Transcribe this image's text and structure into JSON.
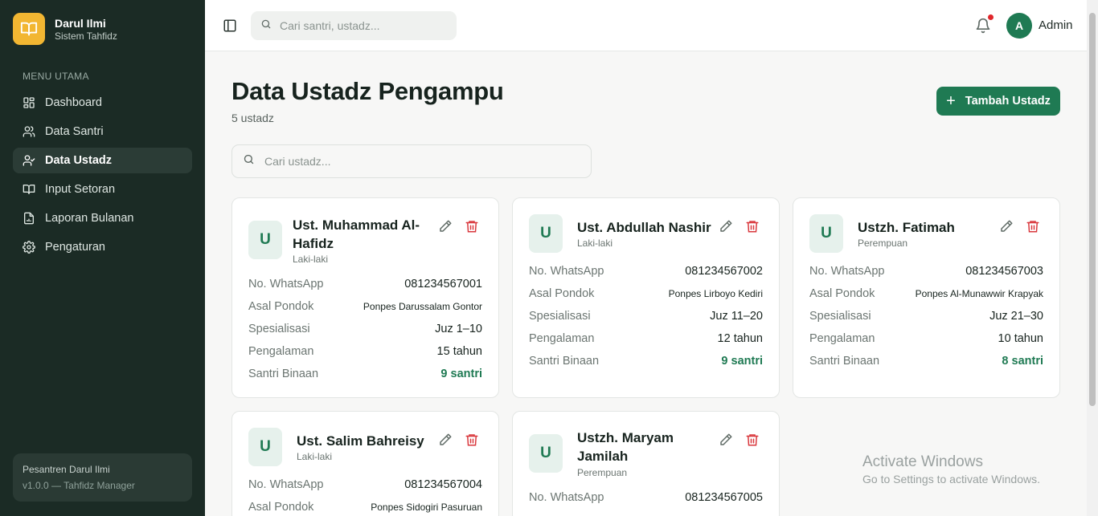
{
  "app": {
    "name": "Darul Ilmi",
    "subtitle": "Sistem Tahfidz"
  },
  "sidebar": {
    "menu_title": "MENU UTAMA",
    "items": [
      {
        "label": "Dashboard",
        "icon": "grid-icon"
      },
      {
        "label": "Data Santri",
        "icon": "users-icon"
      },
      {
        "label": "Data Ustadz",
        "icon": "user-check-icon",
        "active": true
      },
      {
        "label": "Input Setoran",
        "icon": "book-open-icon"
      },
      {
        "label": "Laporan Bulanan",
        "icon": "file-chart-icon"
      },
      {
        "label": "Pengaturan",
        "icon": "gear-icon"
      }
    ],
    "footer": {
      "line1": "Pesantren Darul Ilmi",
      "line2": "v1.0.0 — Tahfidz Manager"
    }
  },
  "topbar": {
    "search_placeholder": "Cari santri, ustadz...",
    "avatar_initial": "A",
    "user_name": "Admin"
  },
  "page": {
    "title": "Data Ustadz Pengampu",
    "count": "5 ustadz",
    "add_button": "Tambah Ustadz",
    "search_placeholder": "Cari ustadz..."
  },
  "labels": {
    "whatsapp": "No. WhatsApp",
    "pondok": "Asal Pondok",
    "spesialisasi": "Spesialisasi",
    "pengalaman": "Pengalaman",
    "santri": "Santri Binaan"
  },
  "ustadz": [
    {
      "initial": "U",
      "name_l1": "Ust. Muhammad Al-",
      "name_l2": "Hafidz",
      "gender": "Laki-laki",
      "whatsapp": "081234567001",
      "pondok": "Ponpes Darussalam Gontor",
      "spesialisasi": "Juz 1–10",
      "pengalaman": "15 tahun",
      "santri": "9 santri"
    },
    {
      "initial": "U",
      "name_l1": "Ust. Abdullah Nashir",
      "gender": "Laki-laki",
      "whatsapp": "081234567002",
      "pondok": "Ponpes Lirboyo Kediri",
      "spesialisasi": "Juz 11–20",
      "pengalaman": "12 tahun",
      "santri": "9 santri"
    },
    {
      "initial": "U",
      "name_l1": "Ustzh. Fatimah",
      "gender": "Perempuan",
      "whatsapp": "081234567003",
      "pondok": "Ponpes Al-Munawwir Krapyak",
      "spesialisasi": "Juz 21–30",
      "pengalaman": "10 tahun",
      "santri": "8 santri"
    },
    {
      "initial": "U",
      "name_l1": "Ust. Salim Bahreisy",
      "gender": "Laki-laki",
      "whatsapp": "081234567004",
      "pondok": "Ponpes Sidogiri Pasuruan"
    },
    {
      "initial": "U",
      "name_l1": "Ustzh. Maryam",
      "name_l2": "Jamilah",
      "gender": "Perempuan",
      "whatsapp": "081234567005"
    }
  ],
  "watermark": {
    "line1": "Activate Windows",
    "line2": "Go to Settings to activate Windows."
  },
  "colors": {
    "primary": "#1f7a53",
    "sidebar": "#1b2b25",
    "accent": "#f2b632",
    "danger": "#d9373c"
  }
}
